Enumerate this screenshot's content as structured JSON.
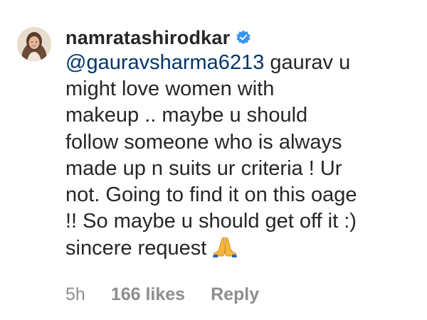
{
  "comment": {
    "username": "namratashirodkar",
    "verified": true,
    "mention": "@gauravsharma6213",
    "lines": [
      " gaurav u",
      "might love women with",
      "makeup .. maybe u should",
      "follow someone  who is always",
      "made up n suits ur criteria !  Ur",
      "not. Going to find it on this oage",
      "!! So maybe u should get off it :)",
      "sincere request"
    ],
    "emoji": "folded-hands-icon",
    "time": "5h",
    "likes": "166 likes",
    "reply_label": "Reply"
  },
  "colors": {
    "text": "#262626",
    "mention": "#00376b",
    "meta": "#8e8e8e",
    "verified": "#3897f0"
  }
}
